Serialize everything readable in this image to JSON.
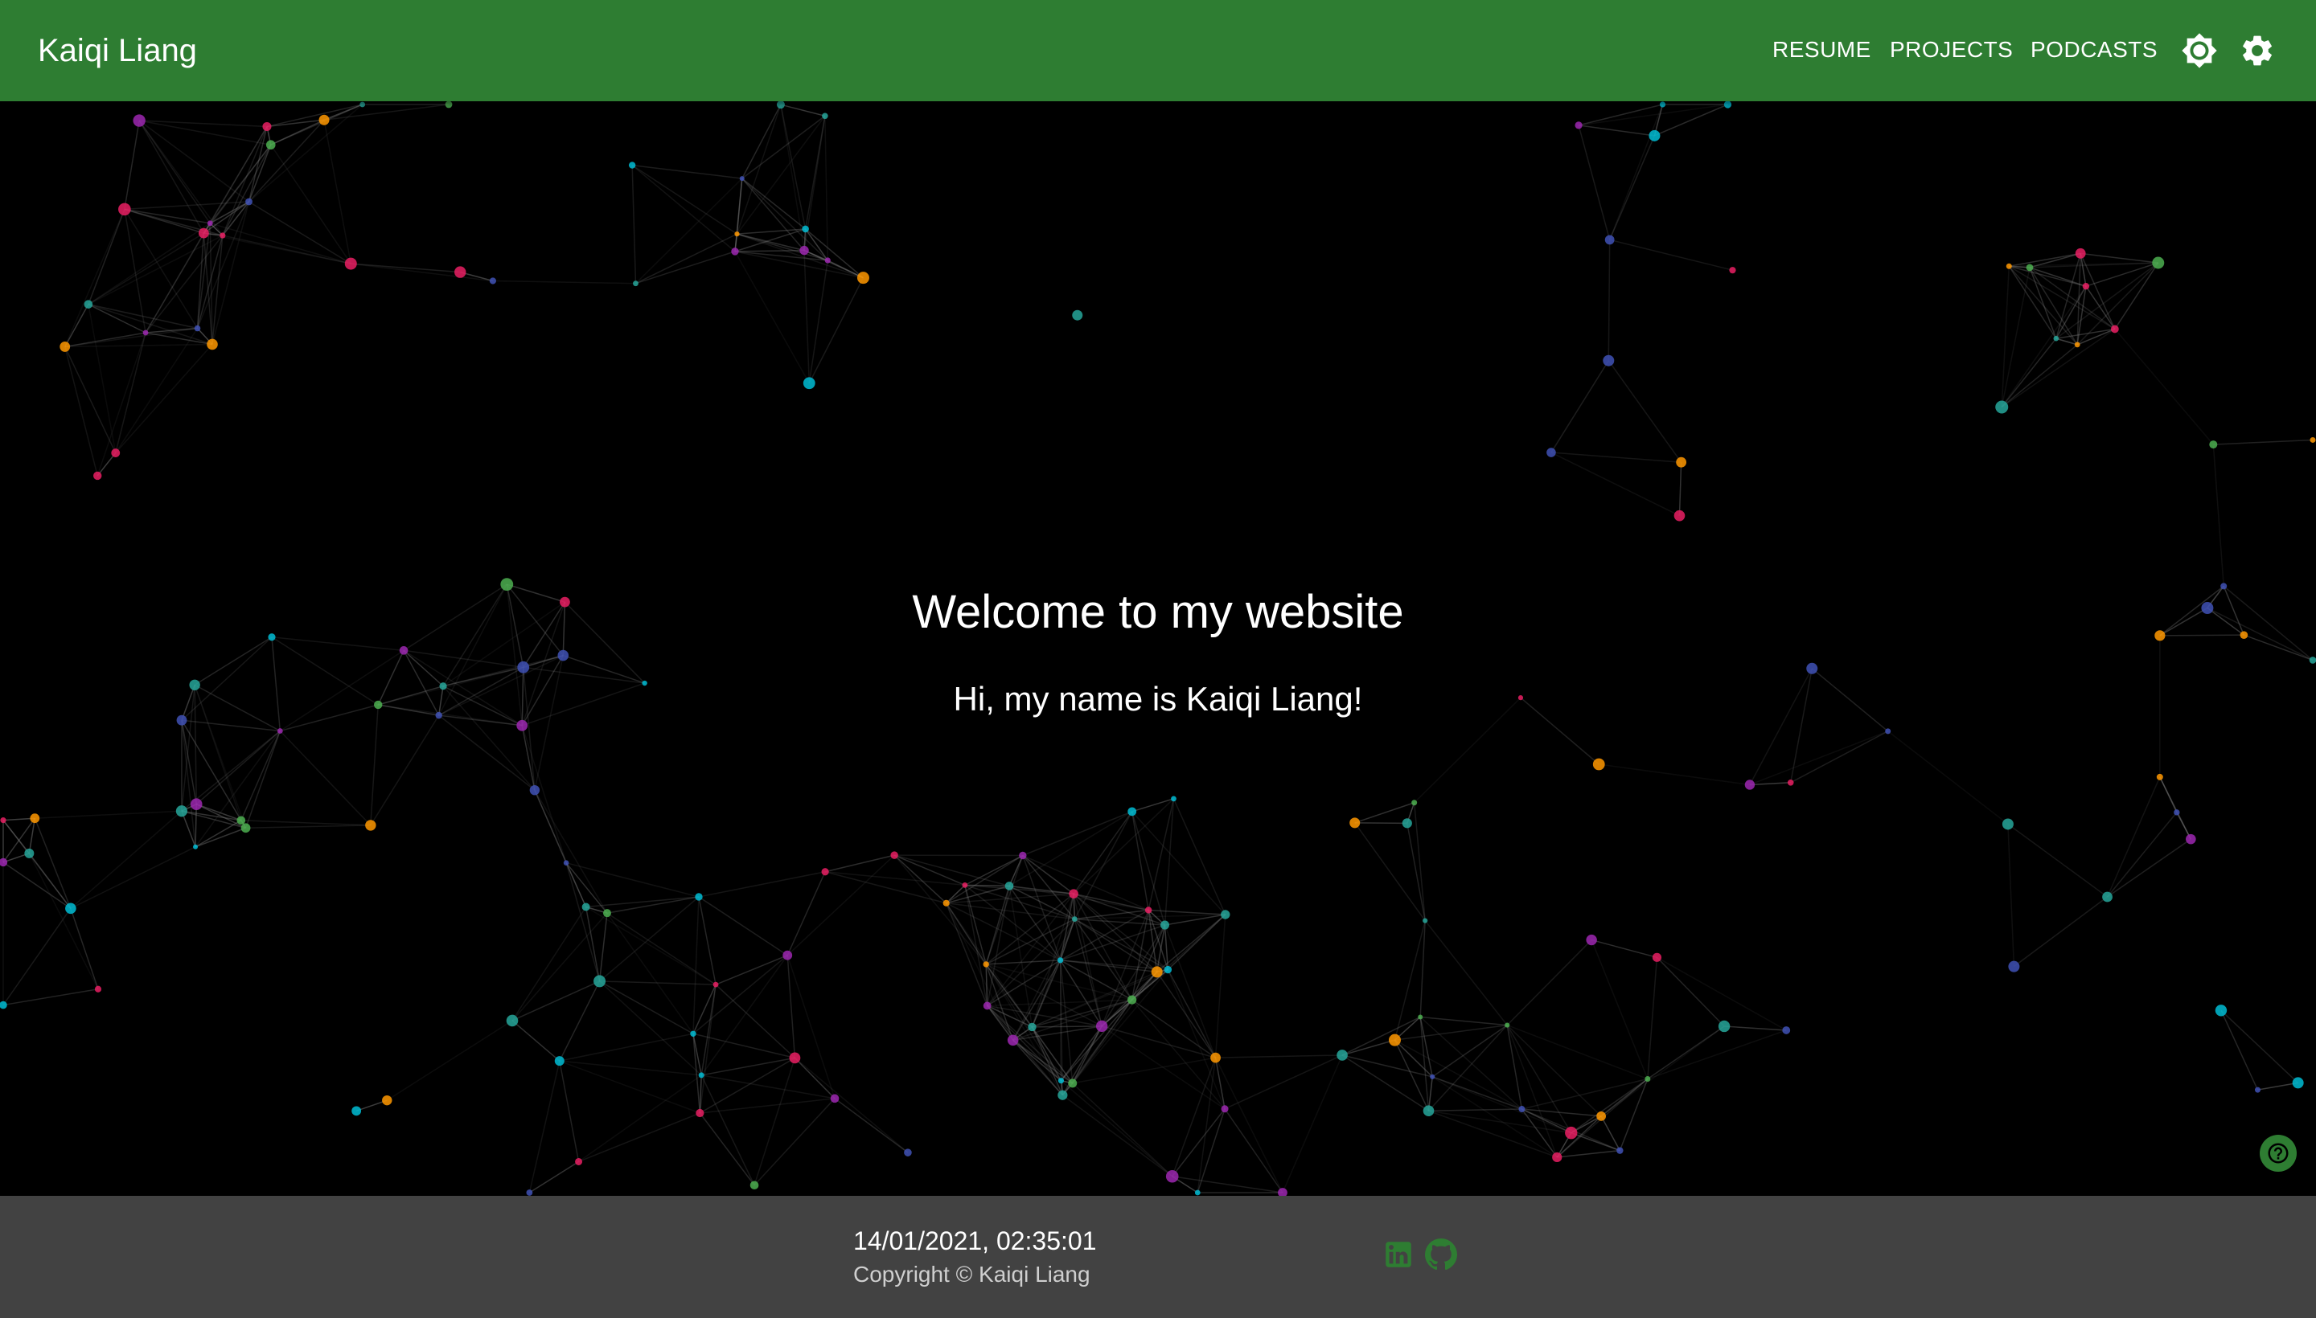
{
  "header": {
    "brand": "Kaiqi Liang",
    "nav": [
      {
        "label": "RESUME"
      },
      {
        "label": "PROJECTS"
      },
      {
        "label": "PODCASTS"
      }
    ],
    "icons": {
      "theme": "brightness-icon",
      "settings": "gear-icon"
    },
    "color": "#2e7d32"
  },
  "hero": {
    "title": "Welcome to my website",
    "subtitle": "Hi, my name is Kaiqi Liang!",
    "background": "#000000",
    "particle_colors": [
      "#26a69a",
      "#e91e63",
      "#00bcd4",
      "#4caf50",
      "#ff9800",
      "#3f51b5",
      "#9c27b0"
    ]
  },
  "help": {
    "icon": "help-icon"
  },
  "footer": {
    "datetime": "14/01/2021, 02:35:01",
    "copyright": "Copyright © Kaiqi Liang",
    "social": [
      {
        "icon": "linkedin-icon"
      },
      {
        "icon": "github-icon"
      }
    ],
    "background": "#424242",
    "icon_color": "#2e7d32"
  }
}
